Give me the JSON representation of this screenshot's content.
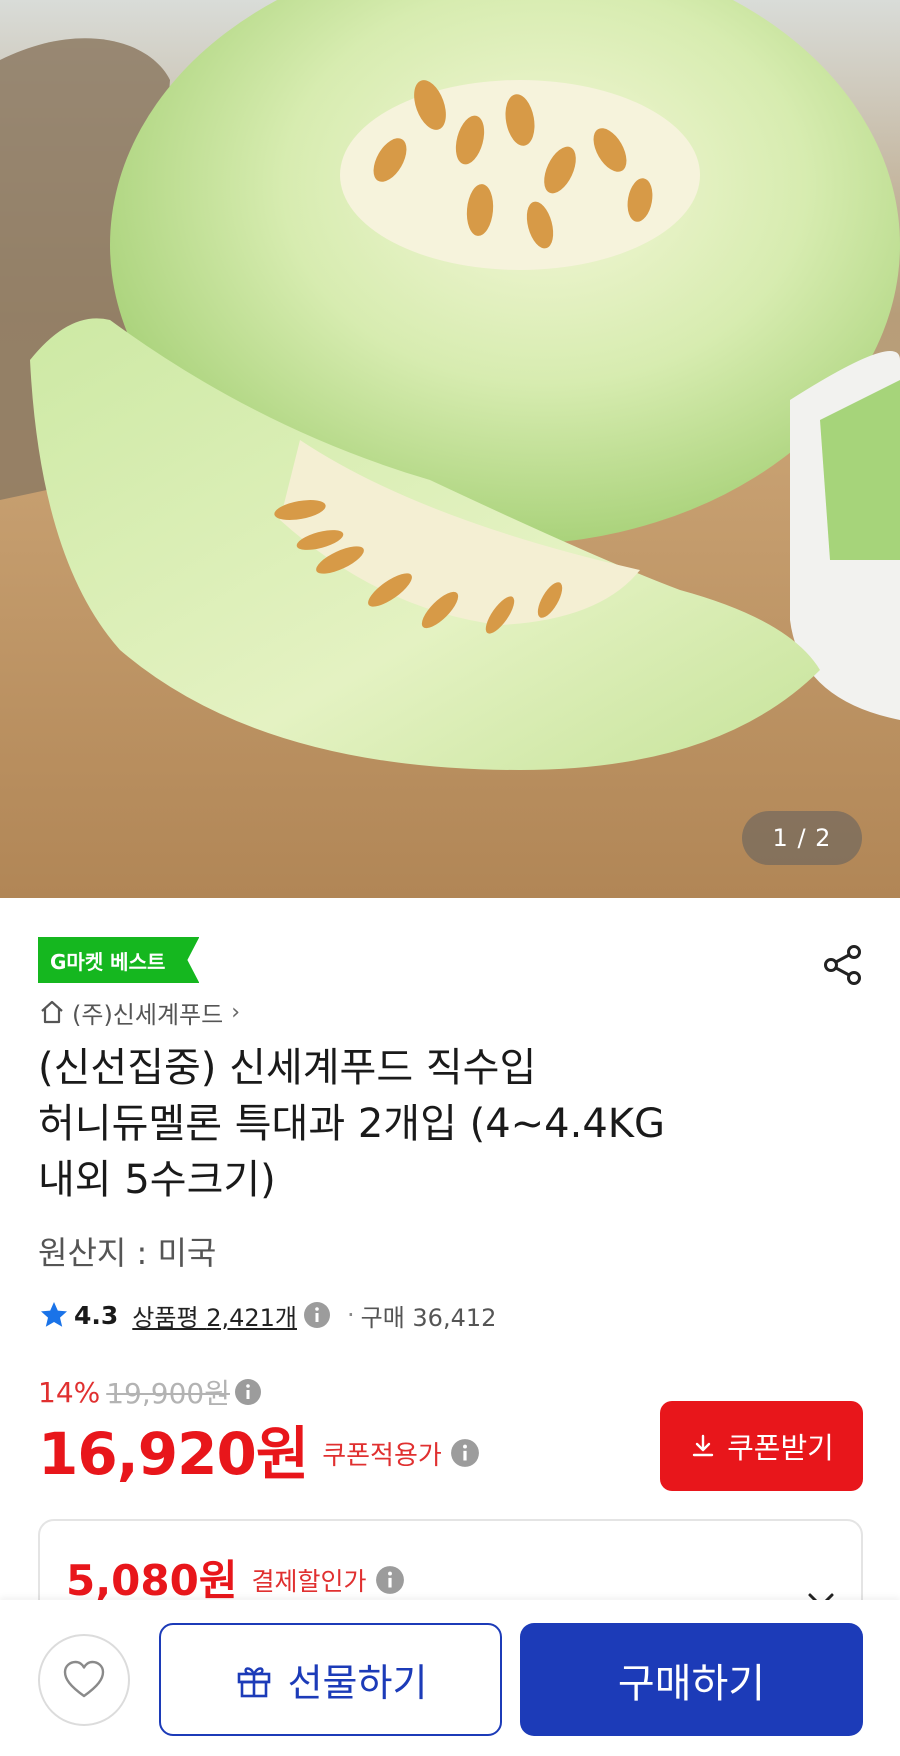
{
  "hero": {
    "image_alt": "honeydew melon",
    "counter": "1 / 2"
  },
  "product": {
    "badge": "G마켓 베스트",
    "seller": "(주)신세계푸드",
    "title_lines": [
      "(신선집중) 신세계푸드 직수입",
      "허니듀멜론 특대과 2개입 (4~4.4KG",
      "내외 5수크기)"
    ],
    "origin": "원산지 : 미국",
    "rating": "4.3",
    "review_label": "상품평",
    "review_count": "2,421개",
    "separator": "·",
    "purchases": "구매 36,412"
  },
  "price": {
    "discount_pct": "14%",
    "original": "19,900원",
    "coupon_price": "16,920원",
    "coupon_price_label": "쿠폰적용가",
    "coupon_button": "쿠폰받기"
  },
  "payment": {
    "price": "5,080원",
    "label": "결제할인가"
  },
  "bottom_bar": {
    "gift_label": "선물하기",
    "buy_label": "구매하기"
  },
  "colors": {
    "accent_red": "#e8161b",
    "primary_blue": "#1c3bb8",
    "badge_green": "#15b71f",
    "star_blue": "#1a73e8"
  },
  "icons": [
    "home-icon",
    "share-icon",
    "star-icon",
    "info-icon",
    "download-icon",
    "chevron-down-icon",
    "heart-icon",
    "gift-icon"
  ]
}
